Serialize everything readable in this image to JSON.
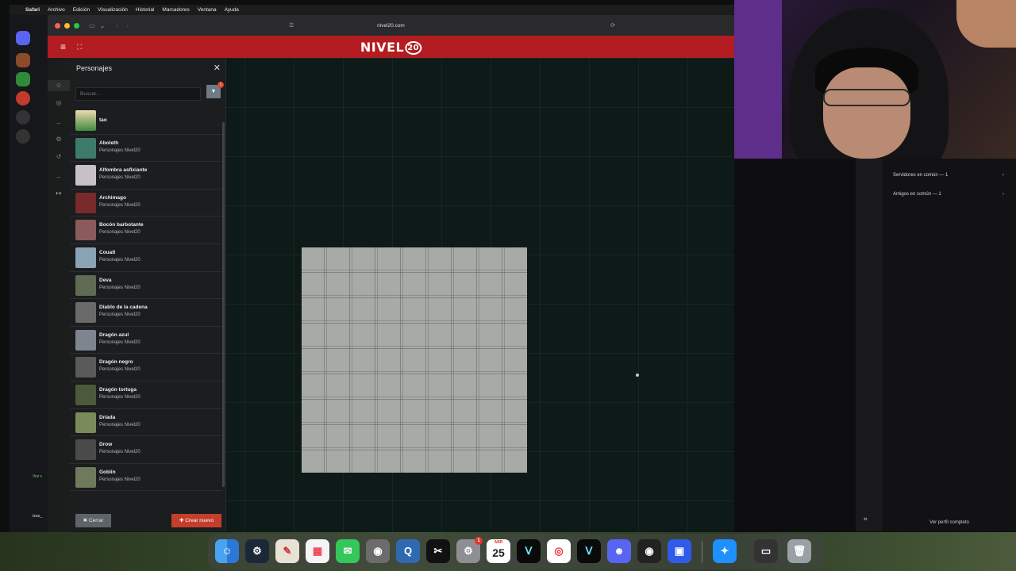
{
  "menubar": {
    "app": "Safari",
    "items": [
      "Archivo",
      "Edición",
      "Visualización",
      "Historial",
      "Marcadores",
      "Ventana",
      "Ayuda"
    ]
  },
  "browser": {
    "url": "nivel20.com",
    "brand": "NIVEL",
    "brand_number": "20"
  },
  "panel": {
    "title": "Personajes",
    "search_placeholder": "Buscar...",
    "filter_badge": "1",
    "characters": [
      {
        "name": "tao",
        "source": ""
      },
      {
        "name": "Aboleth",
        "source": "Personajes Nivel20"
      },
      {
        "name": "Alfombra asfixiante",
        "source": "Personajes Nivel20"
      },
      {
        "name": "Archimago",
        "source": "Personajes Nivel20"
      },
      {
        "name": "Bocón barbotante",
        "source": "Personajes Nivel20"
      },
      {
        "name": "Couatl",
        "source": "Personajes Nivel20"
      },
      {
        "name": "Deva",
        "source": "Personajes Nivel20"
      },
      {
        "name": "Diablo de la cadena",
        "source": "Personajes Nivel20"
      },
      {
        "name": "Dragón azul",
        "source": "Personajes Nivel20"
      },
      {
        "name": "Dragón negro",
        "source": "Personajes Nivel20"
      },
      {
        "name": "Dragón tortuga",
        "source": "Personajes Nivel20"
      },
      {
        "name": "Dríada",
        "source": "Personajes Nivel20"
      },
      {
        "name": "Drow",
        "source": "Personajes Nivel20"
      },
      {
        "name": "Goblin",
        "source": "Personajes Nivel20"
      }
    ],
    "close_label": "✖ Cerrar",
    "new_label": "✚ Crear nuevo"
  },
  "map_tools": {
    "players_count": "6"
  },
  "discord_panel": {
    "servers_common": "Servidores en común — 1",
    "friends_common": "Amigos en común — 1",
    "view_full": "Ver perfil completo"
  },
  "dock": {
    "calendar_month": "ABR",
    "calendar_day": "25",
    "settings_badge": "1"
  },
  "discord_left": {
    "voice_label": "Voz c",
    "user_label": "tzao_"
  },
  "colors": {
    "brand_red": "#b31c20",
    "accent_orange": "#c43e2b"
  }
}
